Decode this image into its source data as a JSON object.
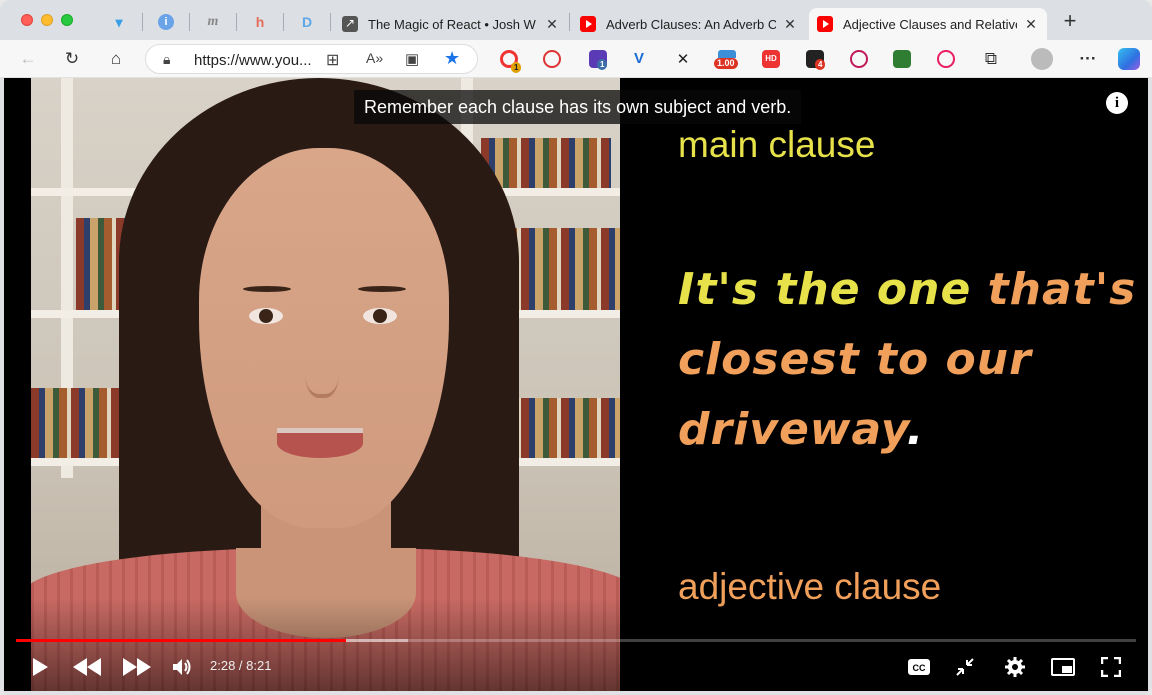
{
  "browser": {
    "tabs": [
      {
        "title": "The Magic of React • Josh W Comeau",
        "favicon": "arrow-icon"
      },
      {
        "title": "Adverb Clauses: An Adverb Clause",
        "favicon": "youtube-icon"
      },
      {
        "title": "Adjective Clauses and Relative Pronouns",
        "favicon": "youtube-icon",
        "active": true
      }
    ],
    "url": "https://www.you...",
    "extension_badges": {
      "ext1": "1",
      "ext3": "1",
      "speed": "1.00",
      "hd": "HD",
      "ext4": "4"
    }
  },
  "video": {
    "caption": "Remember each clause has its own subject and verb.",
    "slide": {
      "label_top": "main clause",
      "sentence": [
        "It's the one",
        "that's",
        "closest to our",
        "driveway",
        "."
      ],
      "label_bottom": "adjective clause"
    },
    "current_time": "2:28",
    "duration": "8:21",
    "time_display": "2:28 / 8:21",
    "played_fraction": 0.295,
    "buffered_fraction": 0.35
  },
  "colors": {
    "main_clause": "#e8e24a",
    "adjective_clause": "#f0a05a",
    "progress": "#ff0000"
  }
}
